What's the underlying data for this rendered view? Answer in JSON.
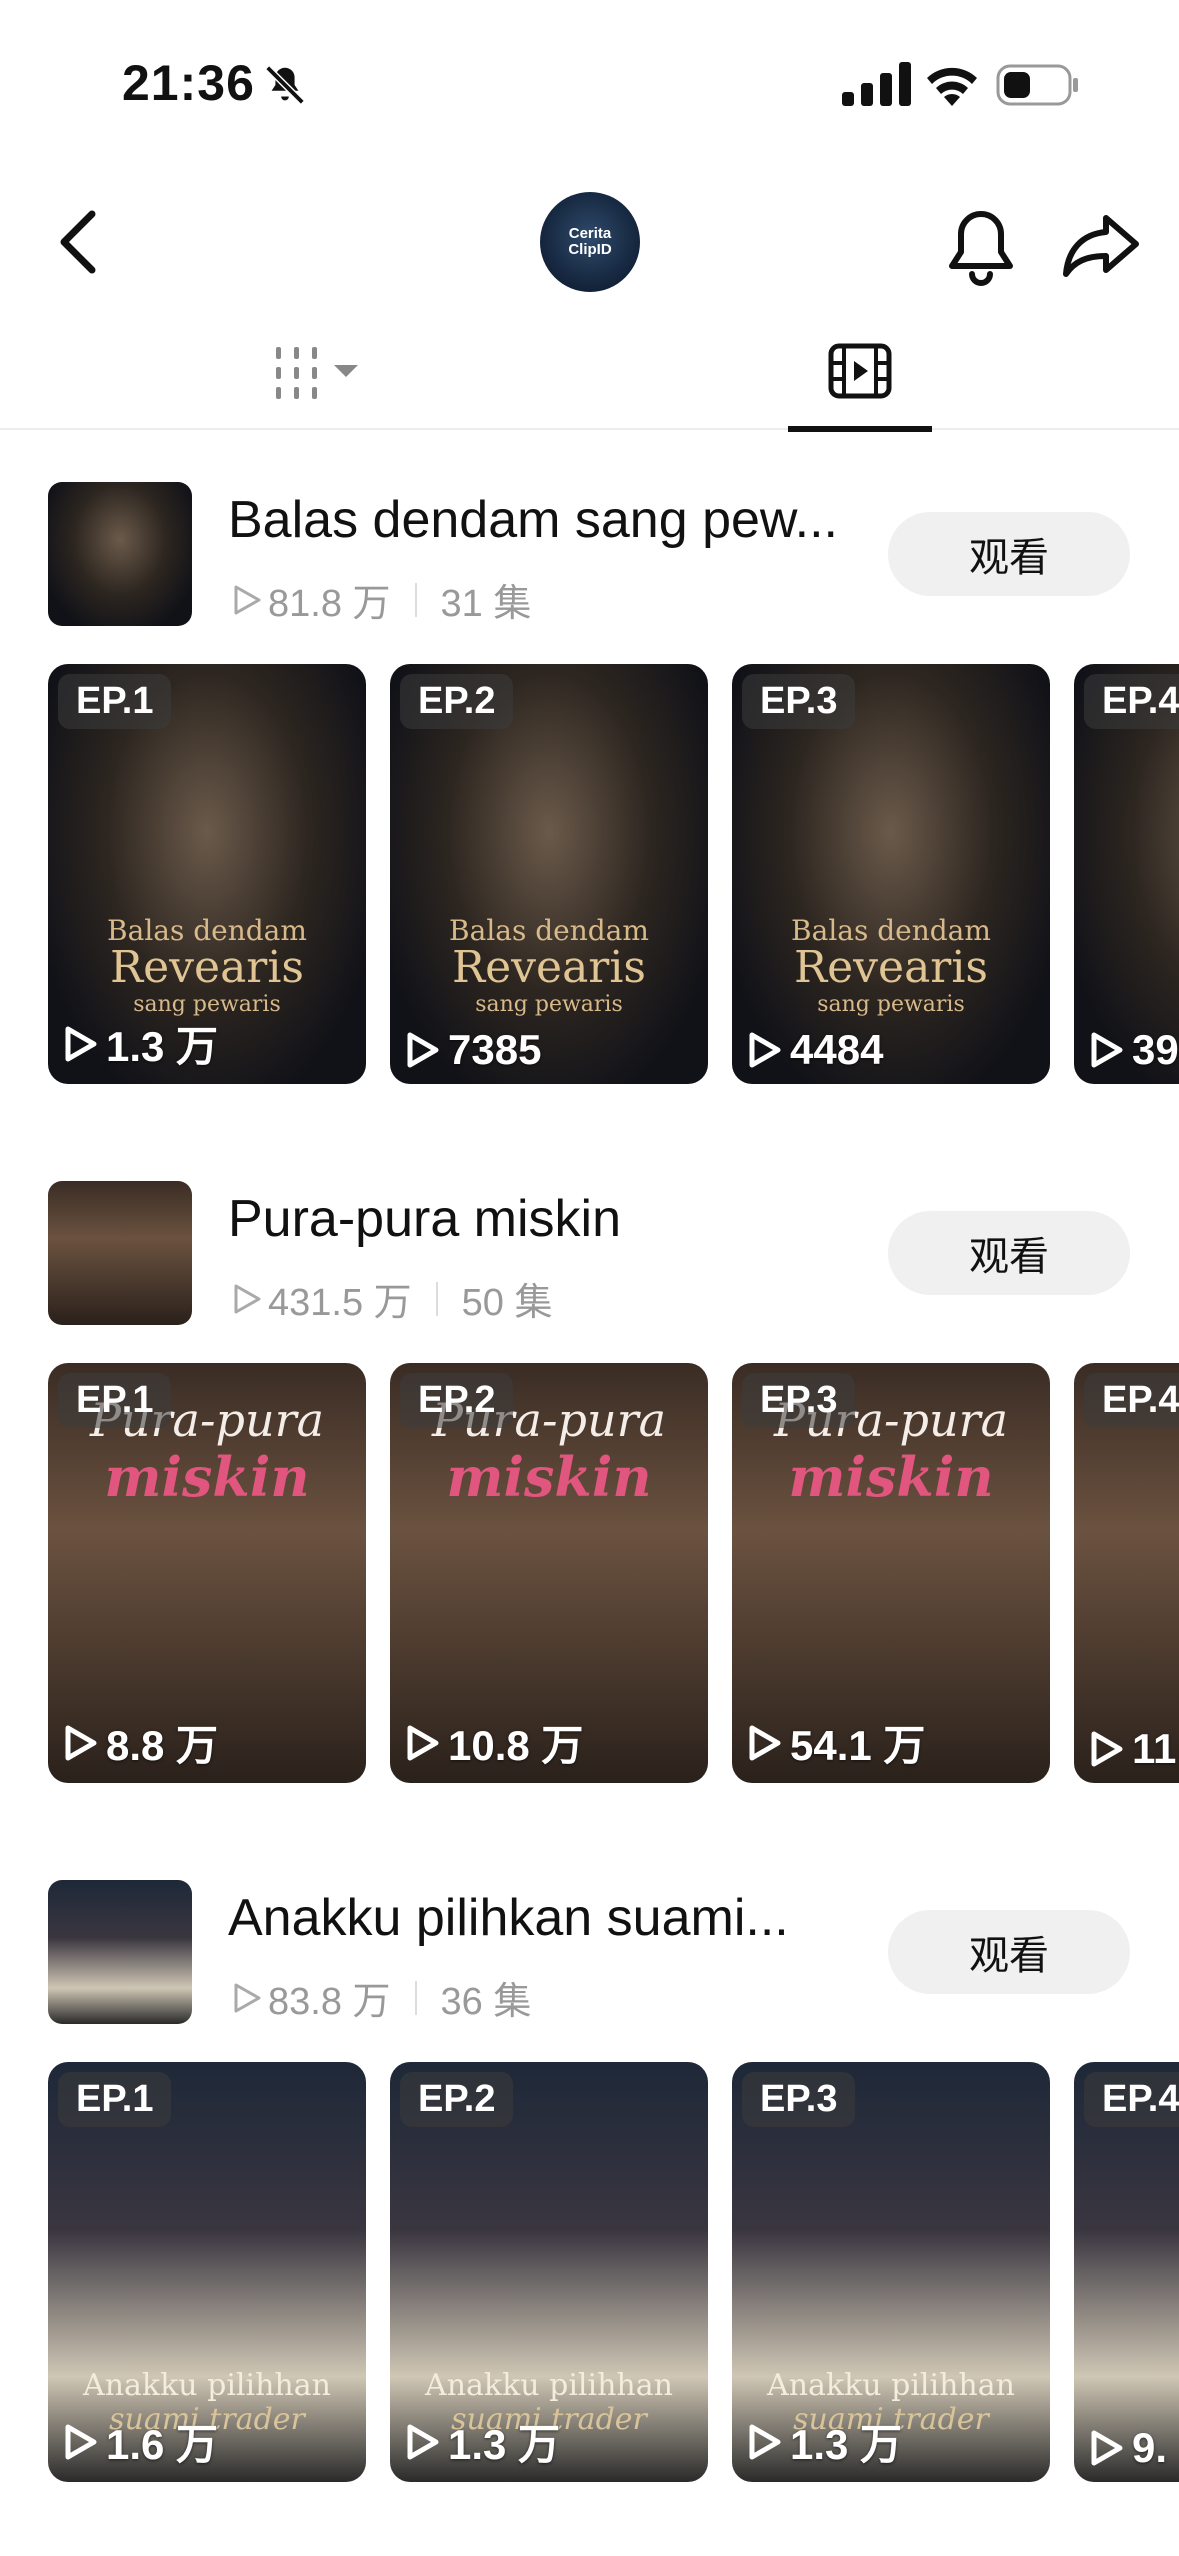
{
  "status_bar": {
    "time": "21:36"
  },
  "header": {
    "channel_name_line1": "Cerita",
    "channel_name_line2": "ClipID"
  },
  "series": [
    {
      "title": "Balas dendam sang pew...",
      "views": "81.8 万",
      "episodes_count": "31 集",
      "watch_label": "观看",
      "art_line1": "Balas dendam",
      "art_line2": "Revearis",
      "art_line3": "sang pewaris",
      "episodes": [
        {
          "label": "EP.1",
          "views": "1.3 万"
        },
        {
          "label": "EP.2",
          "views": "7385"
        },
        {
          "label": "EP.3",
          "views": "4484"
        },
        {
          "label": "EP.4",
          "views": "39"
        }
      ]
    },
    {
      "title": "Pura-pura miskin",
      "views": "431.5 万",
      "episodes_count": "50 集",
      "watch_label": "观看",
      "art_line1": "Pura-pura",
      "art_line2": "miskin",
      "art_line3": "",
      "episodes": [
        {
          "label": "EP.1",
          "views": "8.8 万"
        },
        {
          "label": "EP.2",
          "views": "10.8 万"
        },
        {
          "label": "EP.3",
          "views": "54.1 万"
        },
        {
          "label": "EP.4",
          "views": "11"
        }
      ]
    },
    {
      "title": "Anakku pilihkan suami...",
      "views": "83.8 万",
      "episodes_count": "36 集",
      "watch_label": "观看",
      "art_line1": "Anakku pilihhan",
      "art_line2": "suami trader",
      "art_line3": "",
      "episodes": [
        {
          "label": "EP.1",
          "views": "1.6 万"
        },
        {
          "label": "EP.2",
          "views": "1.3 万"
        },
        {
          "label": "EP.3",
          "views": "1.3 万"
        },
        {
          "label": "EP.4",
          "views": "9."
        }
      ]
    }
  ]
}
